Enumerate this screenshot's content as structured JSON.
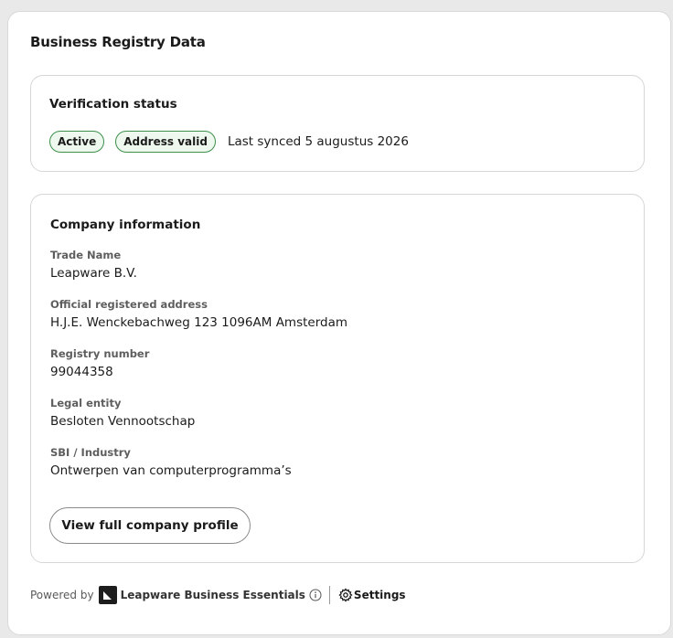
{
  "page": {
    "title": "Business Registry Data"
  },
  "verification": {
    "title": "Verification status",
    "badges": [
      {
        "label": "Active"
      },
      {
        "label": "Address valid"
      }
    ],
    "last_synced": "Last synced 5 augustus 2026"
  },
  "company": {
    "title": "Company information",
    "fields": [
      {
        "label": "Trade Name",
        "value": "Leapware B.V."
      },
      {
        "label": "Official registered address",
        "value": "H.J.E. Wenckebachweg 123 1096AM Amsterdam"
      },
      {
        "label": "Registry number",
        "value": "99044358"
      },
      {
        "label": "Legal entity",
        "value": "Besloten Vennootschap"
      },
      {
        "label": "SBI / Industry",
        "value": "Ontwerpen van computerprogramma’s"
      }
    ],
    "profile_button": "View full company profile"
  },
  "footer": {
    "powered_by": "Powered by",
    "brand": "Leapware Business Essentials",
    "settings": "Settings",
    "icons": [
      "brand-logo",
      "info-icon",
      "gear-icon"
    ]
  },
  "colors": {
    "badge_border": "#3d8f4c",
    "badge_bg": "#eef8ef",
    "card_border": "#d6d6d6",
    "label_gray": "#5e5e5e"
  }
}
